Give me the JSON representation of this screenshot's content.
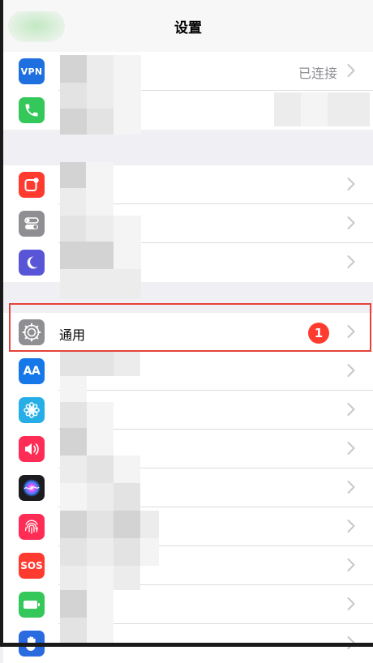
{
  "nav": {
    "title": "设置"
  },
  "rows": {
    "vpn": {
      "icon_text": "VPN",
      "value": "已连接"
    },
    "general": {
      "label": "通用",
      "badge": "1"
    },
    "display": {
      "icon_text": "AA"
    },
    "sos": {
      "icon_text": "SOS"
    }
  },
  "colors": {
    "vpn": "#1e6fe0",
    "phone": "#34c759",
    "notifications": "#ff3b30",
    "control_center": "#8e8e93",
    "do_not_disturb": "#5856d6",
    "general": "#8e8e93",
    "display": "#1677e8",
    "wallpaper": "#27aee6",
    "sounds": "#ff2d55",
    "siri": "#1c1c1e",
    "touch_id": "#ff2d55",
    "sos": "#ff3b30",
    "battery": "#34c759",
    "privacy": "#2a6be0",
    "highlight": "#e5413a"
  }
}
